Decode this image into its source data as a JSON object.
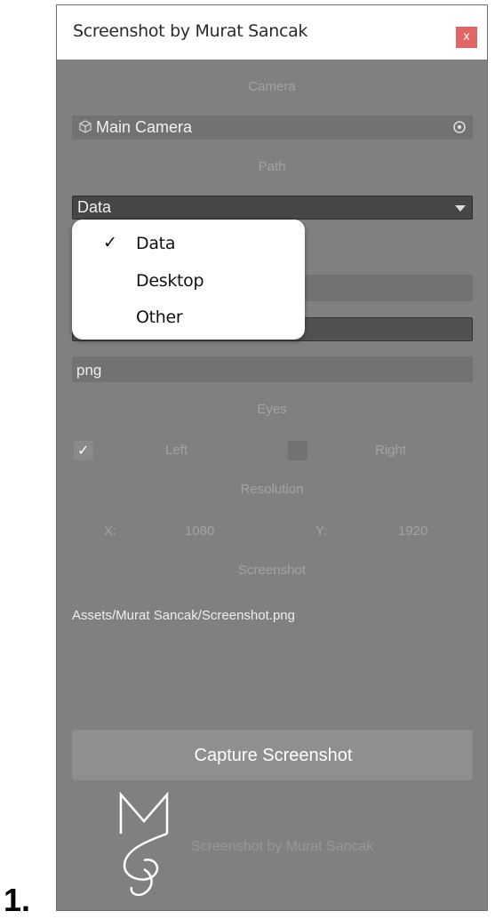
{
  "window": {
    "title": "Screenshot by Murat Sancak",
    "close_label": "x"
  },
  "camera": {
    "section_label": "Camera",
    "value": "Main Camera"
  },
  "path": {
    "section_label": "Path",
    "selected": "Data",
    "options": [
      {
        "label": "Data",
        "checked": true
      },
      {
        "label": "Desktop",
        "checked": false
      },
      {
        "label": "Other",
        "checked": false
      }
    ],
    "check_glyph": "✓"
  },
  "extension": {
    "value": "png"
  },
  "eyes": {
    "section_label": "Eyes",
    "left": {
      "label": "Left",
      "checked": true
    },
    "right": {
      "label": "Right",
      "checked": false
    }
  },
  "resolution": {
    "section_label": "Resolution",
    "x_label": "X:",
    "x_value": "1080",
    "y_label": "Y:",
    "y_value": "1920"
  },
  "screenshot": {
    "section_label": "Screenshot",
    "path_value": "Assets/Murat Sancak/Screenshot.png"
  },
  "capture_button": {
    "label": "Capture Screenshot"
  },
  "footer": {
    "caption": "Screenshot by Murat Sancak"
  },
  "figure": {
    "step_number": "1."
  },
  "colors": {
    "panel": "#808080",
    "close": "#e06666",
    "field": "#727272",
    "dropdown_bg": "#ffffff"
  }
}
